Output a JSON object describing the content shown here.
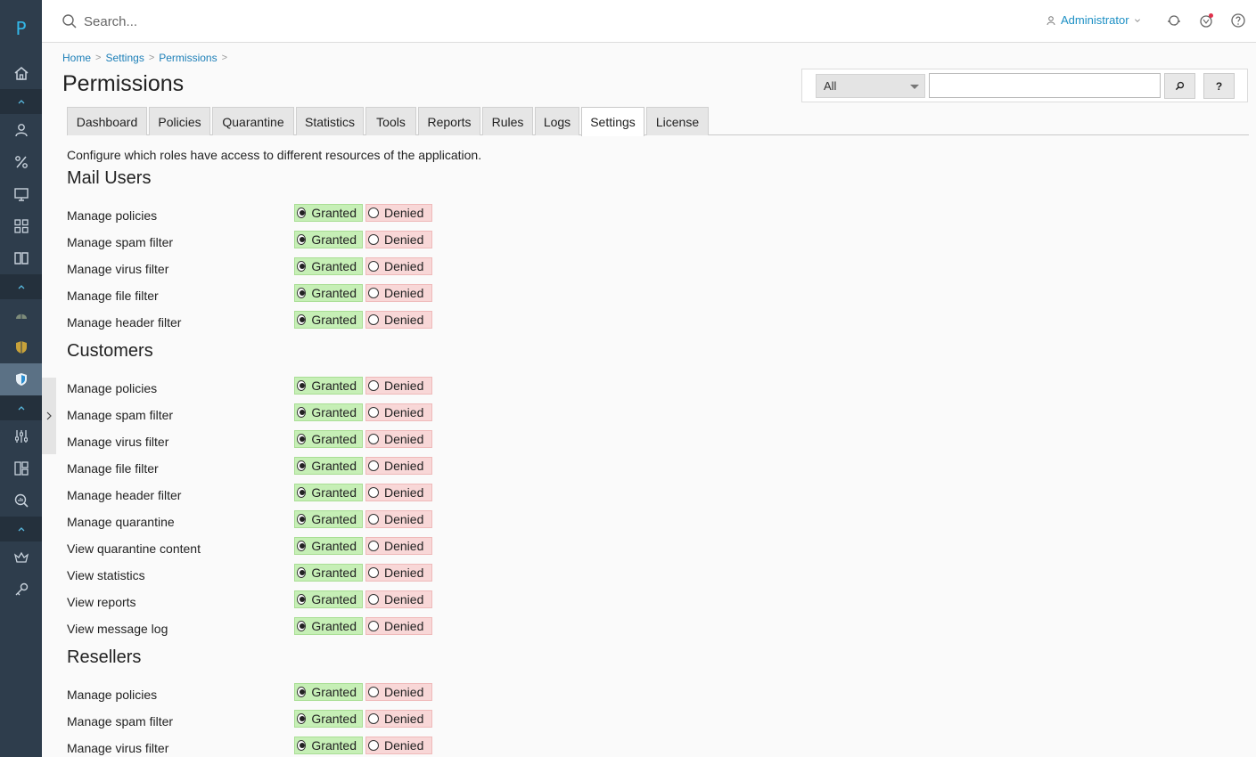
{
  "app": {
    "logo": "P"
  },
  "topbar": {
    "search_placeholder": "Search...",
    "user": "Administrator"
  },
  "breadcrumb": [
    "Home",
    "Settings",
    "Permissions"
  ],
  "page_title": "Permissions",
  "filter": {
    "selected": "All",
    "search_button": "⌕",
    "help_button": "?"
  },
  "tabs": [
    "Dashboard",
    "Policies",
    "Quarantine",
    "Statistics",
    "Tools",
    "Reports",
    "Rules",
    "Logs",
    "Settings",
    "License"
  ],
  "active_tab": "Settings",
  "description": "Configure which roles have access to different resources of the application.",
  "option_labels": {
    "granted": "Granted",
    "denied": "Denied"
  },
  "sections": [
    {
      "title": "Mail Users",
      "items": [
        "Manage policies",
        "Manage spam filter",
        "Manage virus filter",
        "Manage file filter",
        "Manage header filter"
      ]
    },
    {
      "title": "Customers",
      "items": [
        "Manage policies",
        "Manage spam filter",
        "Manage virus filter",
        "Manage file filter",
        "Manage header filter",
        "Manage quarantine",
        "View quarantine content",
        "View statistics",
        "View reports",
        "View message log"
      ]
    },
    {
      "title": "Resellers",
      "items": [
        "Manage policies",
        "Manage spam filter",
        "Manage virus filter"
      ]
    }
  ],
  "colors": {
    "accent": "#1c8fc4",
    "sidebar": "#2e3d4c",
    "granted_bg": "#c6efb6",
    "denied_bg": "#f8d7d7"
  }
}
